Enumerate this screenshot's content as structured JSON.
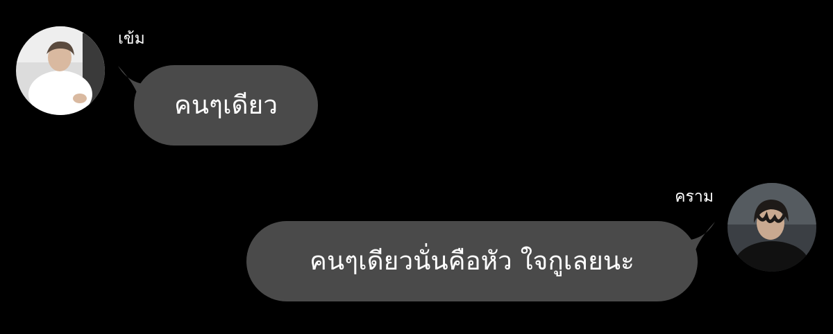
{
  "conversation": {
    "messages": [
      {
        "sender": "เข้ม",
        "side": "left",
        "text": "คนๆเดียว",
        "avatar_icon": "person-white-shirt-photo"
      },
      {
        "sender": "คราม",
        "side": "right",
        "text": "คนๆเดียวนั่นคือหัว ใจกูเลยนะ",
        "avatar_icon": "person-dark-jacket-photo"
      }
    ]
  },
  "colors": {
    "background": "#000000",
    "bubble": "#4a4a4a",
    "text": "#ffffff"
  }
}
